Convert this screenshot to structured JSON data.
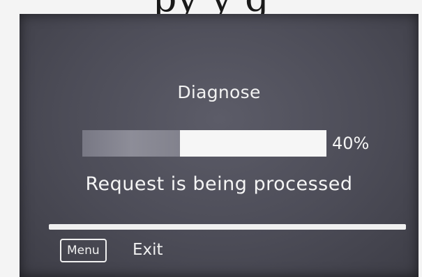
{
  "header_caption": "py         y      g",
  "dialog": {
    "title": "Diagnose",
    "progress_percent": 40,
    "progress_label": "40%",
    "status": "Request is being processed"
  },
  "footer": {
    "menu_label": "Menu",
    "exit_label": "Exit"
  },
  "colors": {
    "screen_background": "#4c4c57",
    "text": "#f5f5f5",
    "progress_fill": "#f6f6f6"
  }
}
